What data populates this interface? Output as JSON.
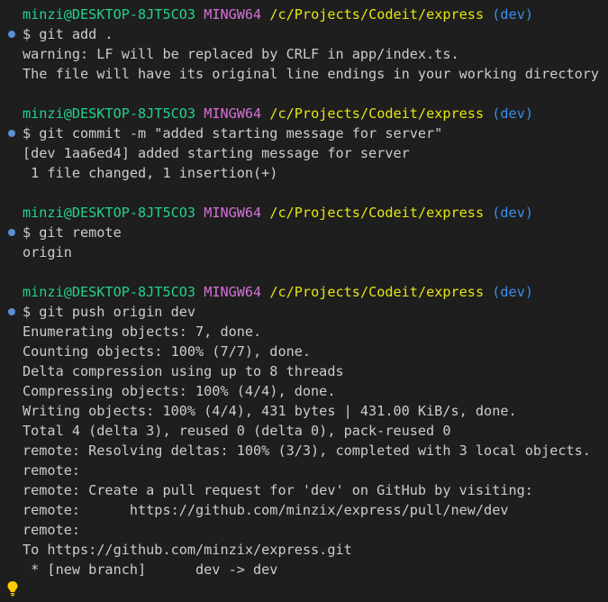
{
  "terminal": {
    "prompt": {
      "user_host": "minzi@DESKTOP-8JT5CO3",
      "shell": "MINGW64",
      "path": "/c/Projects/Codeit/express",
      "branch": "(dev)"
    },
    "blocks": [
      {
        "command": "$ git add .",
        "output": [
          "warning: LF will be replaced by CRLF in app/index.ts.",
          "The file will have its original line endings in your working directory"
        ]
      },
      {
        "command": "$ git commit -m \"added starting message for server\"",
        "output": [
          "[dev 1aa6ed4] added starting message for server",
          " 1 file changed, 1 insertion(+)"
        ]
      },
      {
        "command": "$ git remote",
        "output": [
          "origin"
        ]
      },
      {
        "command": "$ git push origin dev",
        "output": [
          "Enumerating objects: 7, done.",
          "Counting objects: 100% (7/7), done.",
          "Delta compression using up to 8 threads",
          "Compressing objects: 100% (4/4), done.",
          "Writing objects: 100% (4/4), 431 bytes | 431.00 KiB/s, done.",
          "Total 4 (delta 3), reused 0 (delta 0), pack-reused 0",
          "remote: Resolving deltas: 100% (3/3), completed with 3 local objects.",
          "remote:",
          "remote: Create a pull request for 'dev' on GitHub by visiting:",
          "remote:      https://github.com/minzix/express/pull/new/dev",
          "remote:",
          "To https://github.com/minzix/express.git",
          " * [new branch]      dev -> dev"
        ]
      }
    ]
  },
  "icons": {
    "command_marker": "command-decoration-dot-icon",
    "quick_fix": "lightbulb-icon"
  },
  "colors": {
    "background": "#1e1e1e",
    "text": "#cccccc",
    "user_host": "#23d18b",
    "shell": "#d670d6",
    "path": "#e5e510",
    "branch": "#3b8eea",
    "command_marker": "#5b8fd4",
    "lightbulb": "#ffcc00"
  }
}
